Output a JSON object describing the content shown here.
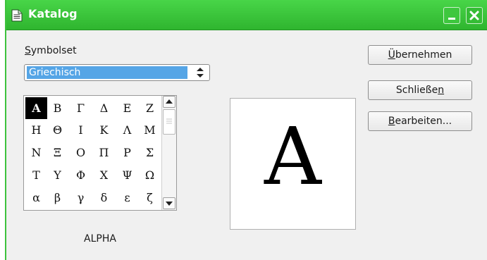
{
  "window": {
    "title": "Katalog",
    "icon": "document-icon",
    "controls": [
      "minimize-icon",
      "close-icon"
    ],
    "accent": "#3dc23d"
  },
  "symbolset": {
    "label_mnemonic": "S",
    "label_rest": "ymbolset",
    "selected": "Griechisch"
  },
  "symbols": {
    "rows": [
      [
        "Α",
        "Β",
        "Γ",
        "Δ",
        "Ε",
        "Ζ"
      ],
      [
        "Η",
        "Θ",
        "Ι",
        "Κ",
        "Λ",
        "Μ"
      ],
      [
        "Ν",
        "Ξ",
        "Ο",
        "Π",
        "Ρ",
        "Σ"
      ],
      [
        "Τ",
        "Υ",
        "Φ",
        "Χ",
        "Ψ",
        "Ω"
      ],
      [
        "α",
        "β",
        "γ",
        "δ",
        "ε",
        "ζ"
      ]
    ],
    "selected_index": 0
  },
  "preview": {
    "glyph": "Α",
    "name": "ALPHA"
  },
  "buttons": {
    "apply": {
      "mnemonic": "Ü",
      "rest": "bernehmen"
    },
    "close": {
      "pre": "Schließe",
      "mnemonic": "n"
    },
    "edit": {
      "mnemonic": "B",
      "rest": "earbeiten..."
    }
  }
}
